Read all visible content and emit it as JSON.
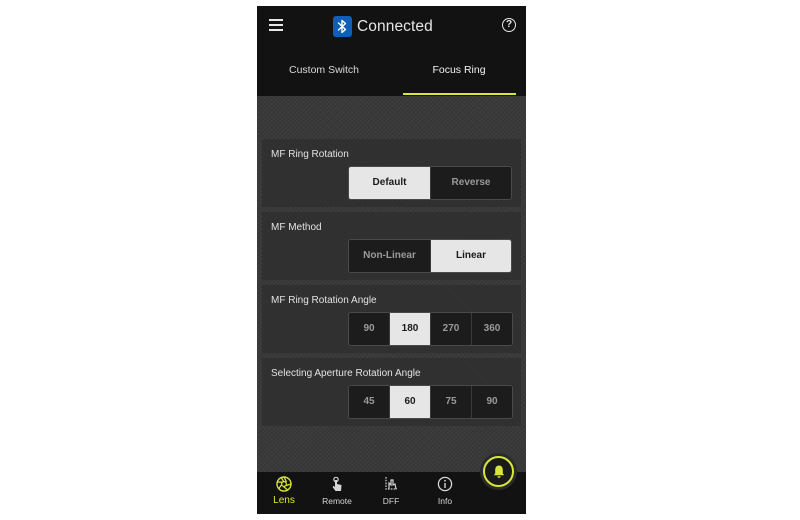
{
  "header": {
    "title": "Connected",
    "help_glyph": "?"
  },
  "tabs": [
    {
      "label": "Custom Switch",
      "active": false
    },
    {
      "label": "Focus Ring",
      "active": true
    }
  ],
  "settings": {
    "mf_ring_rotation": {
      "label": "MF Ring Rotation",
      "options": [
        "Default",
        "Reverse"
      ],
      "selected": "Default"
    },
    "mf_method": {
      "label": "MF Method",
      "options": [
        "Non-Linear",
        "Linear"
      ],
      "selected": "Linear"
    },
    "mf_ring_rotation_angle": {
      "label": "MF Ring Rotation Angle",
      "options": [
        "90",
        "180",
        "270",
        "360"
      ],
      "selected": "180"
    },
    "aperture_rotation_angle": {
      "label": "Selecting Aperture Rotation Angle",
      "options": [
        "45",
        "60",
        "75",
        "90"
      ],
      "selected": "60"
    }
  },
  "bottom_nav": [
    {
      "label": "Lens",
      "icon": "aperture-icon",
      "active": true
    },
    {
      "label": "Remote",
      "icon": "remote-touch-icon",
      "active": false
    },
    {
      "label": "DFF",
      "icon": "dff-icon",
      "active": false
    },
    {
      "label": "Info",
      "icon": "info-icon",
      "active": false
    }
  ],
  "colors": {
    "accent": "#d8e63a",
    "bluetooth": "#0f5fb8",
    "selected_option": "#e6e6e6",
    "unselected_option": "#1c1c1c"
  },
  "fab": {
    "icon": "bell-icon"
  }
}
